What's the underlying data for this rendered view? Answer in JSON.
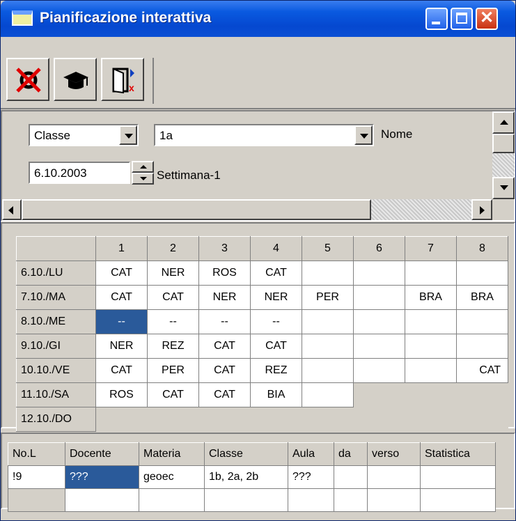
{
  "window": {
    "title": "Pianificazione interattiva",
    "controls": [
      "minimize",
      "maximize",
      "close"
    ]
  },
  "toolbar": {
    "buttons": [
      {
        "name": "delete-lesson",
        "icon": "no-lifebuoy-icon"
      },
      {
        "name": "teacher",
        "icon": "graduation-cap-icon"
      },
      {
        "name": "exit",
        "icon": "exit-door-icon"
      }
    ]
  },
  "filters": {
    "type_select": "Classe",
    "element_select": "1a",
    "name_label": "Nome",
    "date_value": "6.10.2003",
    "week_label": "Settimana-1"
  },
  "grid": {
    "periods": [
      "1",
      "2",
      "3",
      "4",
      "5",
      "6",
      "7",
      "8"
    ],
    "rows": [
      {
        "day": "6.10./LU",
        "cells": [
          "CAT",
          "NER",
          "ROS",
          "CAT",
          "",
          "",
          "",
          ""
        ]
      },
      {
        "day": "7.10./MA",
        "cells": [
          "CAT",
          "CAT",
          "NER",
          "NER",
          "PER",
          "",
          "BRA",
          "BRA"
        ]
      },
      {
        "day": "8.10./ME",
        "cells": [
          "--",
          "--",
          "--",
          "--",
          "",
          "",
          "",
          ""
        ]
      },
      {
        "day": "9.10./GI",
        "cells": [
          "NER",
          "REZ",
          "CAT",
          "CAT",
          "",
          "",
          "",
          ""
        ]
      },
      {
        "day": "10.10./VE",
        "cells": [
          "CAT",
          "PER",
          "CAT",
          "REZ",
          "",
          "",
          "",
          "CAT"
        ]
      },
      {
        "day": "11.10./SA",
        "cells": [
          "ROS",
          "CAT",
          "CAT",
          "BIA",
          ""
        ]
      },
      {
        "day": "12.10./DO",
        "cells": []
      }
    ]
  },
  "lesson_table": {
    "headers": [
      "No.L",
      "Docente",
      "Materia",
      "Classe",
      "Aula",
      "da",
      "verso",
      "Statistica"
    ],
    "rows": [
      [
        "!9",
        "???",
        "geoec",
        "1b, 2a, 2b",
        "???",
        "",
        "",
        ""
      ],
      [
        "",
        "",
        "",
        "",
        "",
        "",
        "",
        ""
      ]
    ]
  },
  "colors": {
    "titlebar": "#0a5ae0",
    "face": "#d4d0c8",
    "selection": "#2a5a9a"
  }
}
